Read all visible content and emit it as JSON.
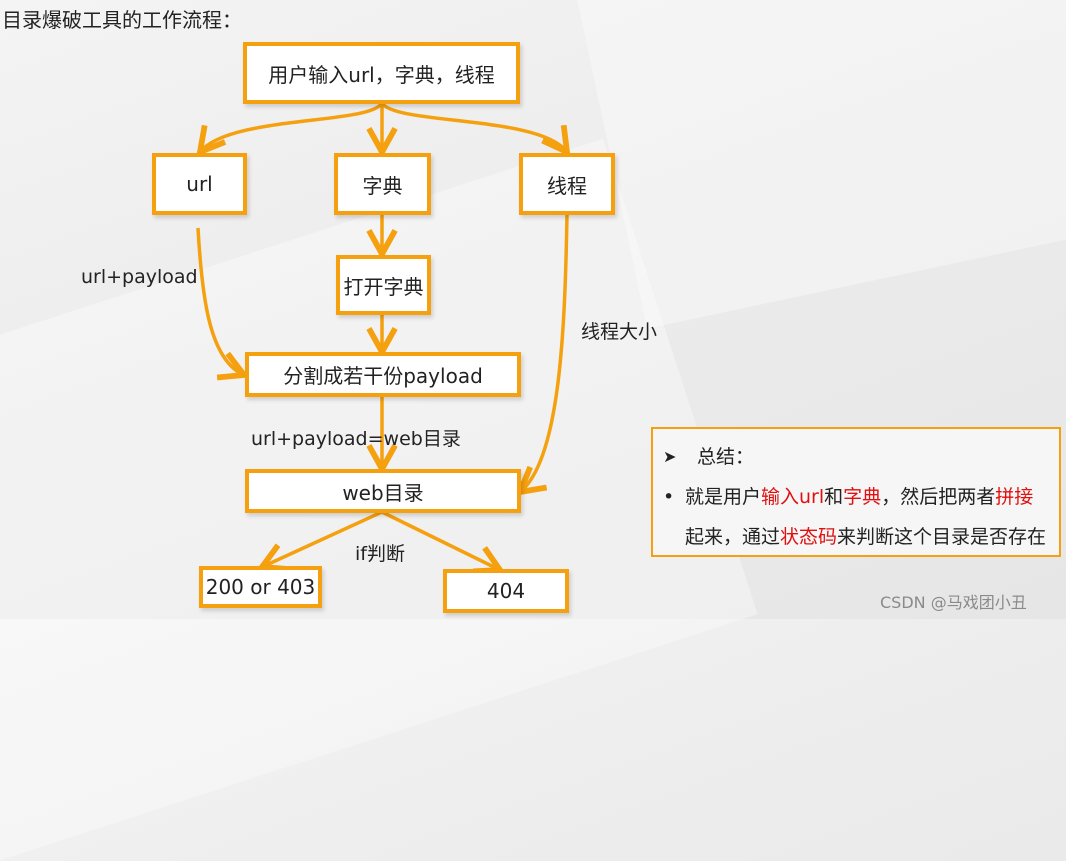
{
  "title": "目录爆破工具的工作流程：",
  "nodes": {
    "input": "用户输入url，字典，线程",
    "url": "url",
    "dict": "字典",
    "thread": "线程",
    "open_dict": "打开字典",
    "split": "分割成若干份payload",
    "web_dir": "web目录",
    "ok": "200 or 403",
    "notfound": "404"
  },
  "edge_labels": {
    "url_payload": "url+payload",
    "thread_size": "线程大小",
    "concat": "url+payload=web目录",
    "if_judge": "if判断"
  },
  "summary": {
    "heading_bullet": "➤",
    "heading": "总结：",
    "bullet": "•",
    "line1_parts": [
      "就是用户",
      "输入url",
      "和",
      "字典",
      "，然后把两者",
      "拼接"
    ],
    "line2_parts": [
      "起来，通过",
      "状态码",
      "来判断这个目录是否存在"
    ]
  },
  "colors": {
    "accent": "#f5a00f",
    "highlight": "#e01010"
  },
  "watermark": "CSDN @马戏团小丑"
}
